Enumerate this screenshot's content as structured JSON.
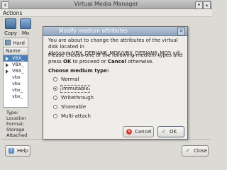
{
  "window": {
    "title": "Virtual Media Manager"
  },
  "menu": {
    "actions": "Actions"
  },
  "toolbar": {
    "copy": "Copy",
    "modify": "Mo"
  },
  "tabs": {
    "hard": "Hard"
  },
  "list": {
    "header": "Name",
    "rows": [
      "VBX_",
      "VBX_",
      "VBX_",
      "vbx",
      "vbx",
      "vbx_",
      "vbx_"
    ]
  },
  "info": {
    "type": "Type:",
    "location": "Location",
    "format": "Format:",
    "storage": "Storage",
    "attached": "Attached"
  },
  "bottom": {
    "help": "Help",
    "close": "Close"
  },
  "dialog": {
    "title": "Modify medium attributes",
    "message": "You are about to change the attributes of the virtual disk located in /data/vm/VBX_DEBIAN6_MOS/VBX_DEBIAN6_MOS.vdi.",
    "prompt_pre": "Please choose one of the following medium types and press ",
    "prompt_ok": "OK",
    "prompt_mid": " to proceed or ",
    "prompt_cancel": "Cancel",
    "prompt_post": " otherwise.",
    "choose_label": "Choose medium type:",
    "options": [
      "Normal",
      "Immutable",
      "Writethrough",
      "Shareable",
      "Multi-attach"
    ],
    "selected": "Immutable",
    "cancel": "Cancel",
    "ok": "OK"
  },
  "colors": {
    "selection": "#4a7fb9",
    "dialog_title": "#8fa4bf"
  }
}
